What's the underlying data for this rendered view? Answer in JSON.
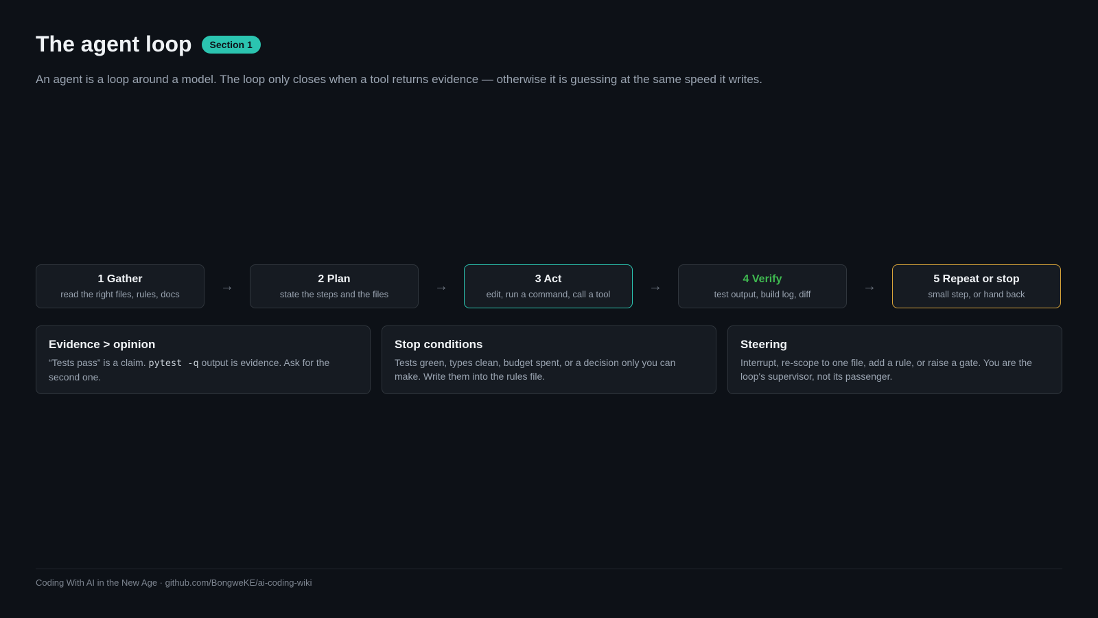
{
  "header": {
    "title": "The agent loop",
    "badge": "Section 1",
    "subtitle": "An agent is a loop around a model. The loop only closes when a tool returns evidence — otherwise it is guessing at the same speed it writes."
  },
  "flow": {
    "arrow_glyph": "→",
    "steps": [
      {
        "title": "1 Gather",
        "desc": "read the right files, rules, docs"
      },
      {
        "title": "2 Plan",
        "desc": "state the steps and the files"
      },
      {
        "title": "3 Act",
        "desc": "edit, run a command, call a tool",
        "border_color": "#2bc4b0"
      },
      {
        "title": "4 Verify",
        "desc": "test output, build log, diff",
        "title_color": "#3fb950"
      },
      {
        "title": "5 Repeat or stop",
        "desc": "small step, or hand back",
        "border_color": "#d9a53a"
      }
    ]
  },
  "cards": [
    {
      "title": "Evidence > opinion",
      "body_before": "“Tests pass” is a claim. ",
      "code": "pytest -q",
      "body_after": " output is evidence. Ask for the second one."
    },
    {
      "title": "Stop conditions",
      "body": "Tests green, types clean, budget spent, or a decision only you can make. Write them into the rules file."
    },
    {
      "title": "Steering",
      "body": "Interrupt, re-scope to one file, add a rule, or raise a gate. You are the loop's supervisor, not its passenger."
    }
  ],
  "footer": {
    "text": "Coding With AI in the New Age · github.com/BongweKE/ai-coding-wiki"
  },
  "colors": {
    "background": "#0d1117",
    "accent_teal": "#2bc4b0",
    "accent_green": "#3fb950",
    "accent_amber": "#d9a53a"
  }
}
